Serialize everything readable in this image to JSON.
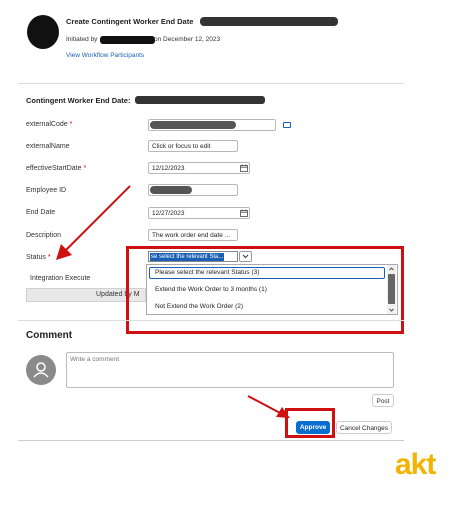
{
  "header": {
    "title": "Create Contingent Worker End Date",
    "initiated_prefix": "Initiated by",
    "initiated_suffix": "on December 12, 2023",
    "view_participants_link": "View Workflow Participants"
  },
  "section_title": "Contingent Worker End Date:",
  "fields": {
    "external_code_label": "externalCode",
    "external_name_label": "externalName",
    "external_name_value": "Click or focus to edit",
    "effective_start_label": "effectiveStartDate",
    "effective_start_value": "12/12/2023",
    "employee_id_label": "Employee ID",
    "end_date_label": "End Date",
    "end_date_value": "12/27/2023",
    "description_label": "Description",
    "description_value": "The work order end date ...",
    "status_label": "Status",
    "status_value": "se select the relevant Sta...",
    "integration_label": "Integration Execute",
    "updated_by_text": "Updated by M"
  },
  "status_dropdown": {
    "options": [
      "Please select the relevant Status (3)",
      "Extend the Work Order to 3 months (1)",
      "Not Extend the Work Order (2)"
    ]
  },
  "comment": {
    "title": "Comment",
    "placeholder": "Write a comment",
    "post_label": "Post"
  },
  "actions": {
    "approve_label": "Approve",
    "cancel_label": "Cancel Changes"
  },
  "logo_text": "akt",
  "colors": {
    "accent_red": "#d01010",
    "link_blue": "#1a5fb4",
    "approve_blue": "#0a6ed1",
    "logo_yellow": "#f2b400"
  }
}
